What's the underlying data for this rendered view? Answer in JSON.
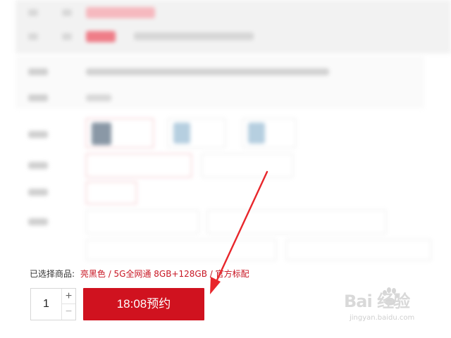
{
  "selected": {
    "label": "已选择商品:",
    "value": "亮黑色 / 5G全网通 8GB+128GB / 官方标配"
  },
  "quantity": {
    "value": "1",
    "plus": "+",
    "minus": "−"
  },
  "reserve_button": {
    "label": "18:08预约"
  },
  "colors": {
    "accent": "#d0121f",
    "accent_text": "#c81623",
    "arrow": "#e8262b"
  },
  "watermark": {
    "logo_text": "Bai 经验",
    "url": "jingyan.baidu.com"
  }
}
